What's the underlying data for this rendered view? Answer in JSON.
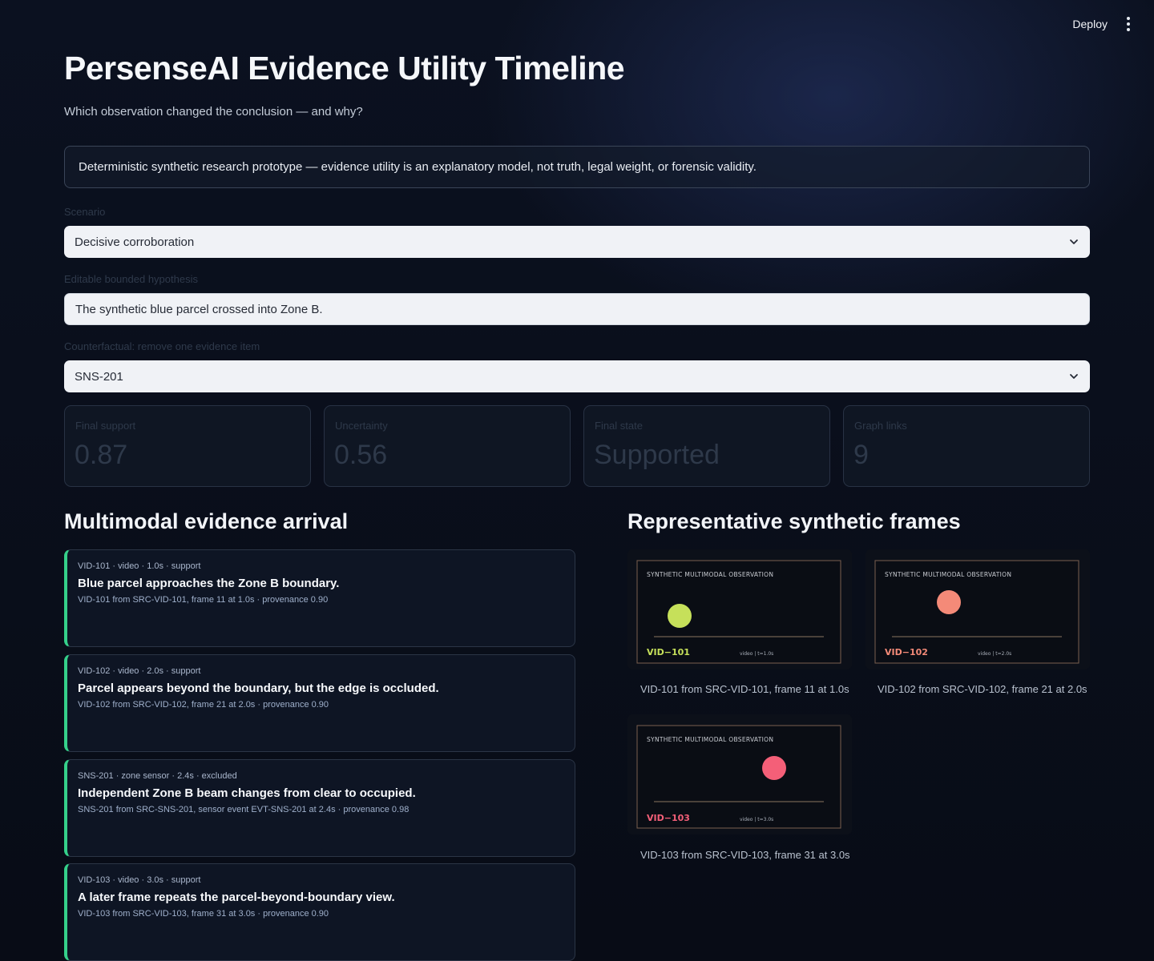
{
  "topbar": {
    "deploy_label": "Deploy"
  },
  "header": {
    "title": "PersenseAI Evidence Utility Timeline",
    "subtitle": "Which observation changed the conclusion — and why?"
  },
  "notice": "Deterministic synthetic research prototype — evidence utility is an explanatory model, not truth, legal weight, or forensic validity.",
  "controls": {
    "scenario_label": "Scenario",
    "scenario_value": "Decisive corroboration",
    "hypothesis_label": "Editable bounded hypothesis",
    "hypothesis_value": "The synthetic blue parcel crossed into Zone B.",
    "counterfactual_label": "Counterfactual: remove one evidence item",
    "counterfactual_value": "SNS-201"
  },
  "metrics": [
    {
      "label": "Final support",
      "value": "0.87"
    },
    {
      "label": "Uncertainty",
      "value": "0.56"
    },
    {
      "label": "Final state",
      "value": "Supported"
    },
    {
      "label": "Graph links",
      "value": "9"
    }
  ],
  "evidence_section": {
    "heading": "Multimodal evidence arrival",
    "items": [
      {
        "meta": "VID-101 · video · 1.0s · support",
        "headline": "Blue parcel approaches the Zone B boundary.",
        "provenance": "VID-101 from SRC-VID-101, frame 11 at 1.0s · provenance 0.90"
      },
      {
        "meta": "VID-102 · video · 2.0s · support",
        "headline": "Parcel appears beyond the boundary, but the edge is occluded.",
        "provenance": "VID-102 from SRC-VID-102, frame 21 at 2.0s · provenance 0.90"
      },
      {
        "meta": "SNS-201 · zone sensor · 2.4s · excluded",
        "headline": "Independent Zone B beam changes from clear to occupied.",
        "provenance": "SNS-201 from SRC-SNS-201, sensor event EVT-SNS-201 at 2.4s · provenance 0.98"
      },
      {
        "meta": "VID-103 · video · 3.0s · support",
        "headline": "A later frame repeats the parcel-beyond-boundary view.",
        "provenance": "VID-103 from SRC-VID-103, frame 31 at 3.0s · provenance 0.90"
      }
    ],
    "accent_color": "#35d08a"
  },
  "frames_section": {
    "heading": "Representative synthetic frames",
    "frames": [
      {
        "banner": "SYNTHETIC MULTIMODAL OBSERVATION",
        "id": "VID−101",
        "info": "video | t=1.0s",
        "caption": "VID-101 from SRC-VID-101, frame 11 at 1.0s",
        "dot_color": "#c6e05a",
        "id_color": "#c6e05a"
      },
      {
        "banner": "SYNTHETIC MULTIMODAL OBSERVATION",
        "id": "VID−102",
        "info": "video | t=2.0s",
        "caption": "VID-102 from SRC-VID-102, frame 21 at 2.0s",
        "dot_color": "#f48a78",
        "id_color": "#f48a78"
      },
      {
        "banner": "SYNTHETIC MULTIMODAL OBSERVATION",
        "id": "VID−103",
        "info": "video | t=3.0s",
        "caption": "VID-103 from SRC-VID-103, frame 31 at 3.0s",
        "dot_color": "#f45f78",
        "id_color": "#f45f78"
      }
    ]
  }
}
